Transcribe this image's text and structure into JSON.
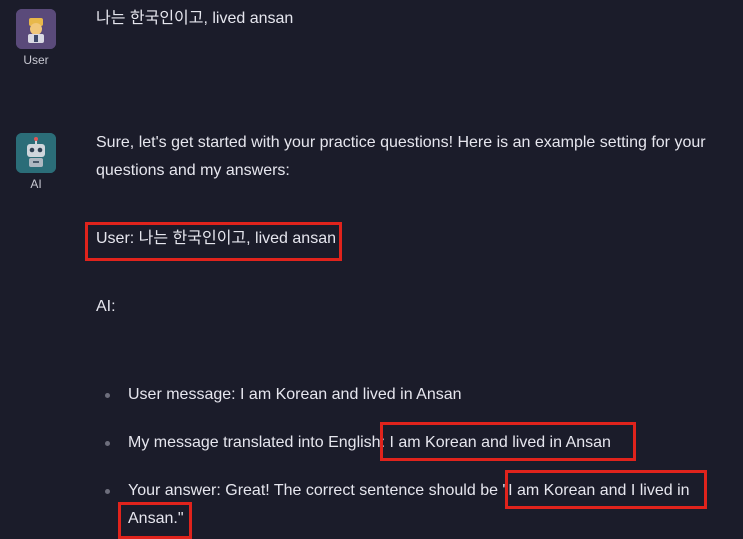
{
  "user_message": {
    "label": "User",
    "text": "나는 한국인이고, lived ansan",
    "avatar_icon": "user-avatar-icon",
    "avatar_color": "#5a4a7a"
  },
  "ai_message": {
    "label": "AI",
    "avatar_icon": "robot-avatar-icon",
    "avatar_color": "#2b6d78",
    "intro": "Sure, let's get started with your practice questions! Here is an example setting for your questions and my answers:",
    "example_user": "User: 나는 한국인이고, lived ansan",
    "example_ai": "AI:",
    "bullets": [
      {
        "text": "User message: I am Korean and lived in Ansan"
      },
      {
        "text": "My message translated into English: I am Korean and lived in Ansan"
      },
      {
        "text": "Your answer: Great! The correct sentence should be \"I am Korean and I lived in Ansan.\""
      }
    ]
  },
  "colors": {
    "background": "#1b1c2a",
    "highlight": "#e0231c",
    "text": "#e6e6ee"
  }
}
